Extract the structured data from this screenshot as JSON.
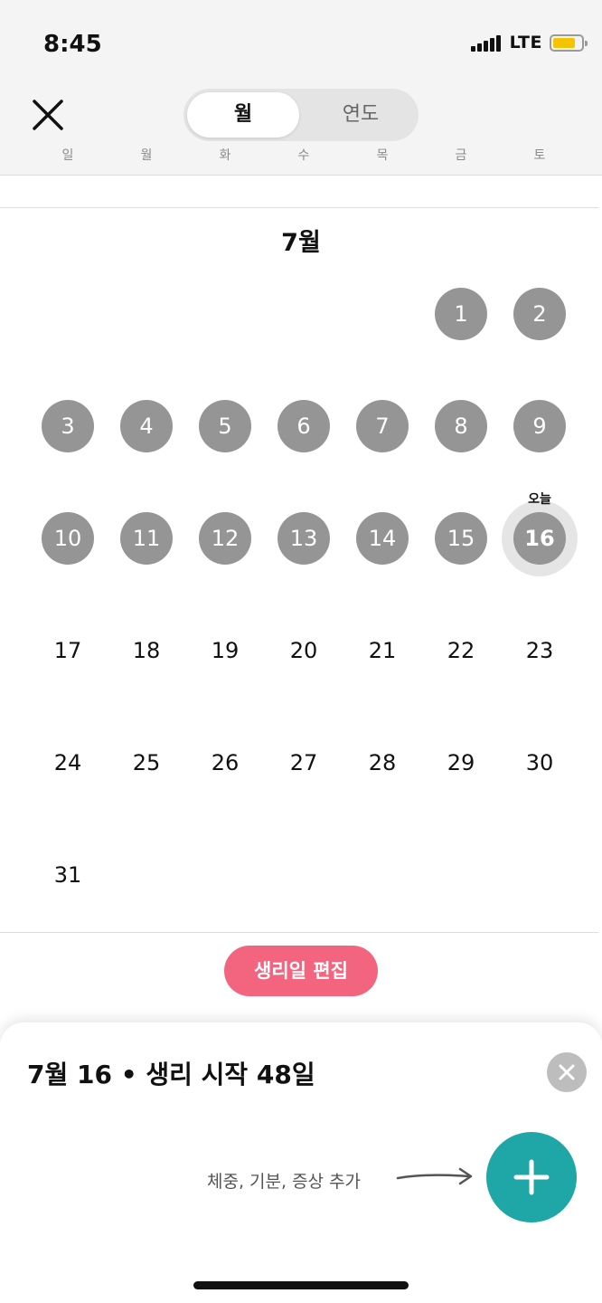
{
  "status_bar": {
    "time": "8:45",
    "network": "LTE",
    "battery_color": "#f5c400"
  },
  "header": {
    "close_icon": "close-x-icon",
    "segments": [
      {
        "label": "월",
        "active": true
      },
      {
        "label": "연도",
        "active": false
      }
    ],
    "weekdays": [
      "일",
      "월",
      "화",
      "수",
      "목",
      "금",
      "토"
    ]
  },
  "calendar": {
    "month_title": "7월",
    "start_weekday_index": 5,
    "days_in_month": 31,
    "period_days": [
      1,
      2,
      3,
      4,
      5,
      6,
      7,
      8,
      9,
      10,
      11,
      12,
      13,
      14,
      15,
      16
    ],
    "today": 16,
    "today_label": "오늘"
  },
  "edit_button": {
    "label": "생리일 편집",
    "color": "#f3657f"
  },
  "sheet": {
    "title": "7월 16 • 생리 시작 48일",
    "close_icon": "close-circle-icon",
    "add_hint": "체중, 기분, 증상 추가",
    "arrow_icon": "arrow-right-icon",
    "add_icon": "plus-icon",
    "add_button_color": "#1fa6a6"
  }
}
